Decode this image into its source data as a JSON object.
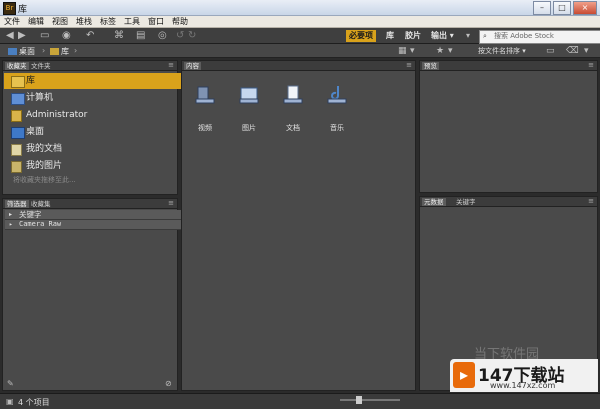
{
  "window": {
    "title": "库",
    "min_label": "–",
    "max_label": "□",
    "close_label": "×"
  },
  "menu": [
    "文件",
    "编辑",
    "视图",
    "堆栈",
    "标签",
    "工具",
    "窗口",
    "帮助"
  ],
  "toolbar": {
    "workspaces": [
      {
        "label": "必要项",
        "active": true
      },
      {
        "label": "库",
        "active": false
      },
      {
        "label": "胶片",
        "active": false
      },
      {
        "label": "输出 ▾",
        "active": false
      }
    ],
    "search_placeholder": "搜索 Adobe Stock"
  },
  "path": {
    "items": [
      "桌面",
      "库"
    ],
    "sort_label": "按文件名排序 ▾"
  },
  "left_top": {
    "tabs": [
      "收藏夹",
      "文件夹"
    ],
    "items": [
      {
        "label": "库",
        "selected": true
      },
      {
        "label": "计算机",
        "selected": false
      },
      {
        "label": "Administrator",
        "selected": false
      },
      {
        "label": "桌面",
        "selected": false
      },
      {
        "label": "我的文档",
        "selected": false
      },
      {
        "label": "我的图片",
        "selected": false
      }
    ],
    "hint": "将收藏夹拖移至此..."
  },
  "left_bottom": {
    "tabs": [
      "筛选器",
      "收藏集"
    ],
    "rows": [
      "关键字",
      "Camera Raw"
    ]
  },
  "content": {
    "tab": "内容",
    "items": [
      {
        "label": "视频",
        "icon": "video-library-icon"
      },
      {
        "label": "图片",
        "icon": "pictures-library-icon"
      },
      {
        "label": "文档",
        "icon": "documents-library-icon"
      },
      {
        "label": "音乐",
        "icon": "music-library-icon"
      }
    ]
  },
  "right_top": {
    "tab": "预览"
  },
  "right_bottom": {
    "tabs": [
      "元数据",
      "关键字"
    ]
  },
  "status": {
    "count": "4 个项目"
  },
  "watermark": {
    "text": "当下软件园",
    "site": "www.147xz.com",
    "brand": "147下载站"
  }
}
